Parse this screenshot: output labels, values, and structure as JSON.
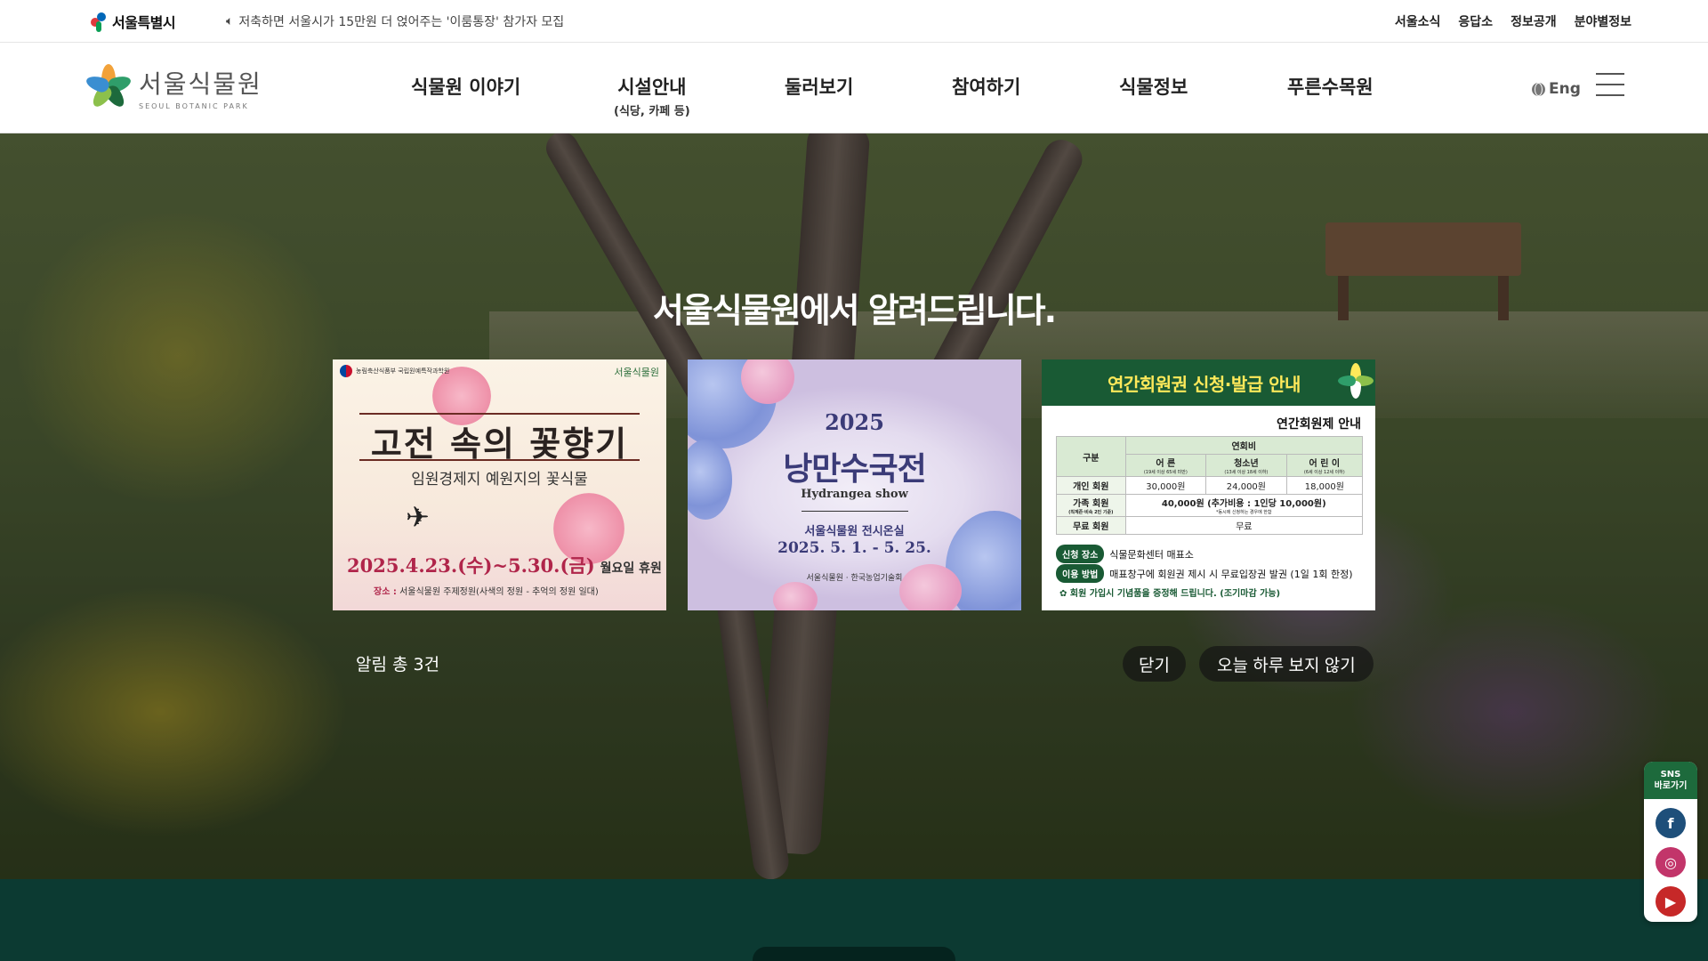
{
  "topbar": {
    "seoul_logo_text": "서울특별시",
    "notice_icon": "speaker-icon",
    "notice_text": "저축하면 서울시가 15만원 더 얹어주는 '이룸통장' 참가자 모집",
    "links": [
      "서울소식",
      "응답소",
      "정보공개",
      "분야별정보"
    ]
  },
  "header": {
    "logo_ko": "서울식물원",
    "logo_en": "SEOUL BOTANIC PARK",
    "nav": [
      {
        "label": "식물원 이야기",
        "sub": ""
      },
      {
        "label": "시설안내",
        "sub": "(식당, 카페 등)"
      },
      {
        "label": "둘러보기",
        "sub": ""
      },
      {
        "label": "참여하기",
        "sub": ""
      },
      {
        "label": "식물정보",
        "sub": ""
      },
      {
        "label": "푸른수목원",
        "sub": ""
      }
    ],
    "lang_label": "Eng",
    "menu_icon": "hamburger-icon"
  },
  "popup": {
    "title": "서울식물원에서 알려드립니다.",
    "count_label": "알림 총 3건",
    "close_label": "닫기",
    "today_label": "오늘 하루 보지 않기",
    "cards": [
      {
        "gov_label": "농림축산식품부 국립원예특작과학원",
        "brand": "서울식물원",
        "title": "고전 속의 꽃향기",
        "subtitle": "임원경제지 예원지의 꽃식물",
        "date": "2025.4.23.(수)~5.30.(금)",
        "date_note": "월요일 휴원",
        "place_label": "장소 :",
        "place": "서울식물원 주제정원(사색의 정원 - 추억의 정원 일대)"
      },
      {
        "year": "2025",
        "title": "낭만수국전",
        "title_en": "Hydrangea show",
        "location": "서울식물원 전시온실",
        "dates": "2025. 5. 1. - 5. 25.",
        "logos": "서울식물원 · 한국농업기술회"
      },
      {
        "header": "연간회원권 신청·발급 안내",
        "subheader": "연간회원제 안내",
        "table_headers": {
          "category": "구분",
          "fee": "연회비",
          "adult": "어 른",
          "adult_note": "(19세 이상 65세 미만)",
          "youth": "청소년",
          "youth_note": "(13세 이상 18세 이하)",
          "child": "어 린 이",
          "child_note": "(6세 이상 12세 이하)"
        },
        "rows": [
          {
            "label": "개인 회원",
            "note": "",
            "values": [
              "30,000원",
              "24,000원",
              "18,000원"
            ]
          },
          {
            "label": "가족 회원",
            "note": "(직계존·비속 2인 기준)",
            "values": [
              "40,000원 (추가비용 : 1인당 10,000원)"
            ],
            "values_note": "*동시에 신청하는 경우에 한함"
          },
          {
            "label": "무료 회원",
            "note": "",
            "values": [
              "무료"
            ]
          }
        ],
        "apply_place_label": "신청 장소",
        "apply_place": "식물문화센터 매표소",
        "usage_label": "이용 방법",
        "usage": "매표창구에 회원권 제시 시 무료입장권 발권 (1일 1회 한정)",
        "gift_note": "회원 가입시 기념품을 증정해 드립니다. (조기마감 가능)"
      }
    ]
  },
  "sns": {
    "label_line1": "SNS",
    "label_line2": "바로가기",
    "items": [
      {
        "name": "facebook-icon",
        "glyph": "f",
        "color": "#1e4f7a"
      },
      {
        "name": "instagram-icon",
        "glyph": "◎",
        "color": "#c2356a"
      },
      {
        "name": "youtube-icon",
        "glyph": "▶",
        "color": "#c62828"
      }
    ]
  },
  "colors": {
    "brand_green": "#195a34",
    "dark_teal": "#0c3a32",
    "accent_yellow": "#ffe95a"
  }
}
